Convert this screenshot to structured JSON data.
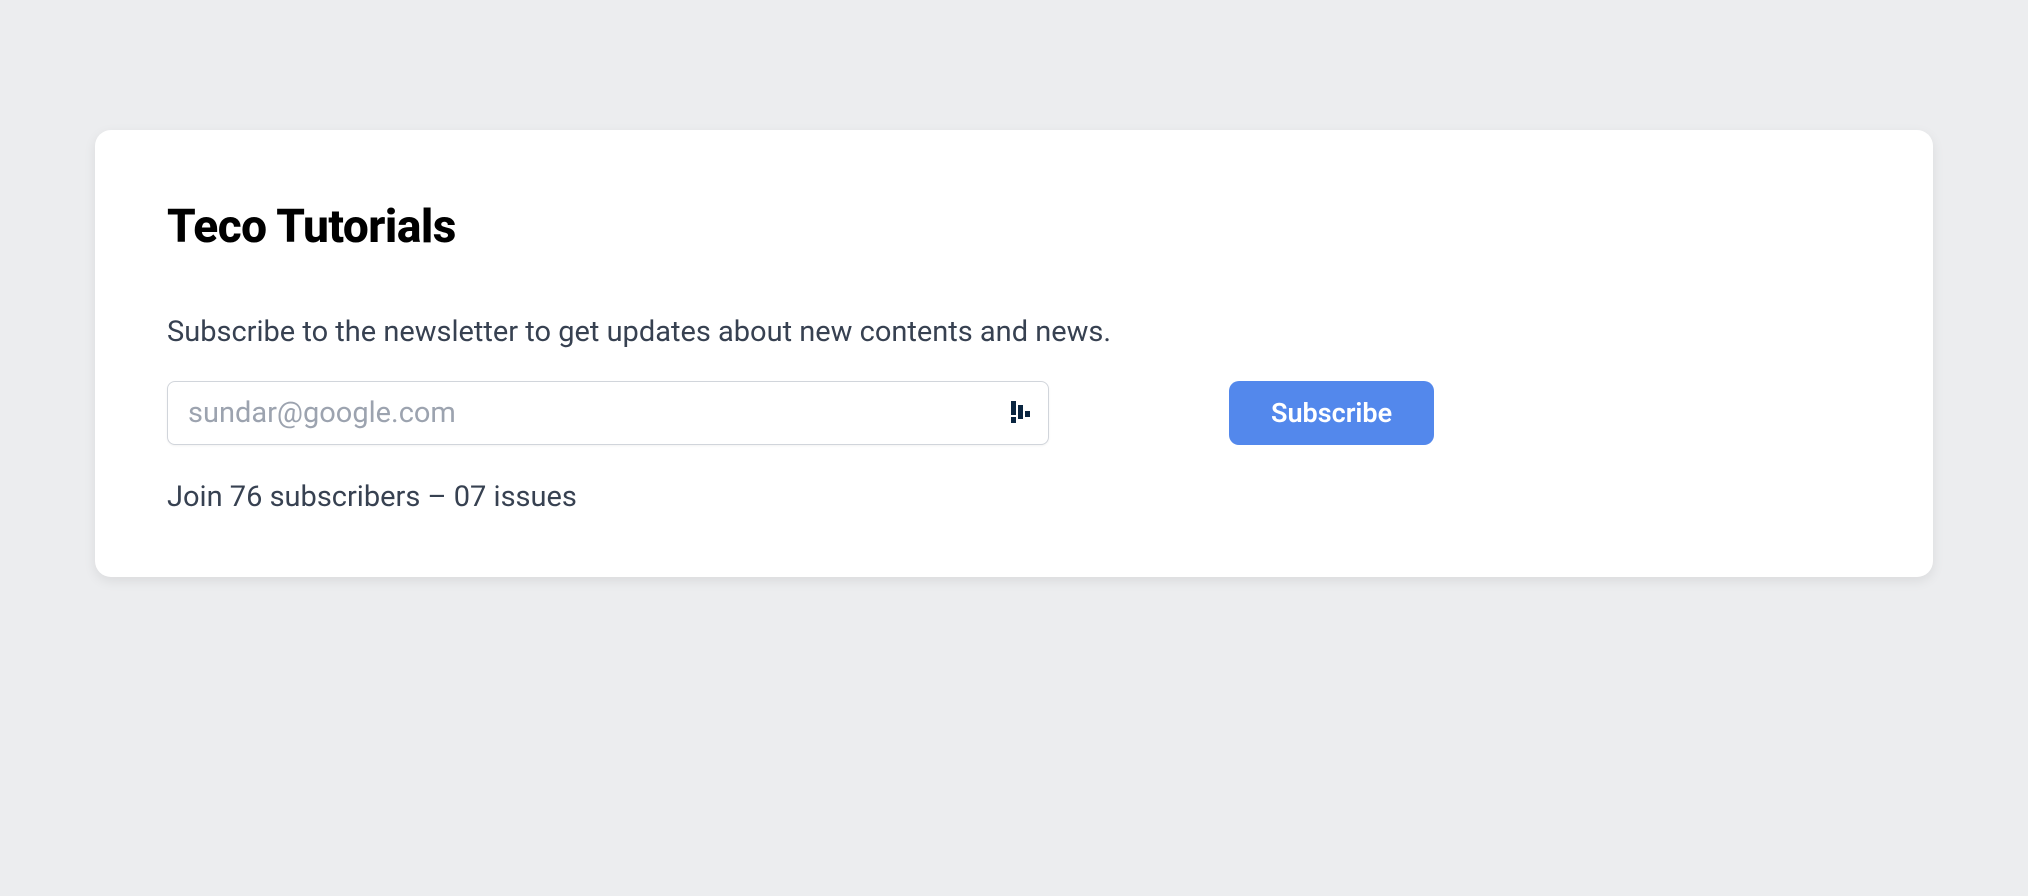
{
  "card": {
    "title": "Teco Tutorials",
    "description": "Subscribe to the newsletter to get updates about new contents and news.",
    "email_placeholder": "sundar@google.com",
    "subscribe_label": "Subscribe",
    "stats": "Join 76 subscribers – 07 issues"
  }
}
